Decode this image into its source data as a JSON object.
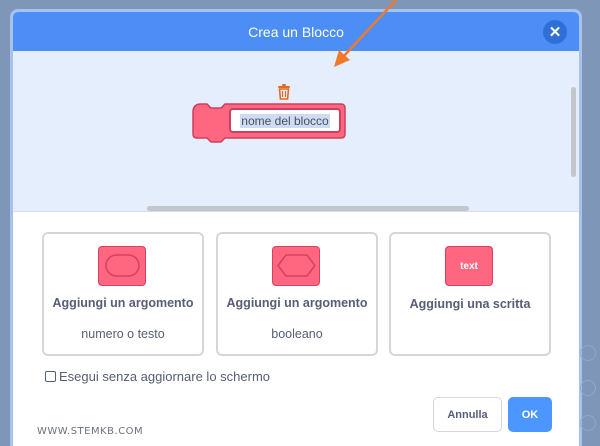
{
  "dialog": {
    "title": "Crea un Blocco",
    "close_icon": "close-icon"
  },
  "block": {
    "name_value": "nome del blocco",
    "color": "#ff6680",
    "border_color": "#cf3e5c"
  },
  "options": [
    {
      "title": "Aggiungi un argomento",
      "subtitle": "numero o testo",
      "icon": "round-input-icon"
    },
    {
      "title": "Aggiungi un argomento",
      "subtitle": "booleano",
      "icon": "diamond-input-icon"
    },
    {
      "title": "Aggiungi una scritta",
      "subtitle": "",
      "icon": "text-label-icon",
      "icon_text": "text"
    }
  ],
  "checkbox": {
    "label": "Esegui senza aggiornare lo schermo",
    "checked": false
  },
  "buttons": {
    "cancel_label": "Annulla",
    "ok_label": "OK"
  },
  "watermark": "WWW.STEMKB.COM",
  "colors": {
    "header": "#4c8ef5",
    "workspace": "#e5eefd",
    "ok": "#4c97ff",
    "arrow": "#f07a2a"
  }
}
